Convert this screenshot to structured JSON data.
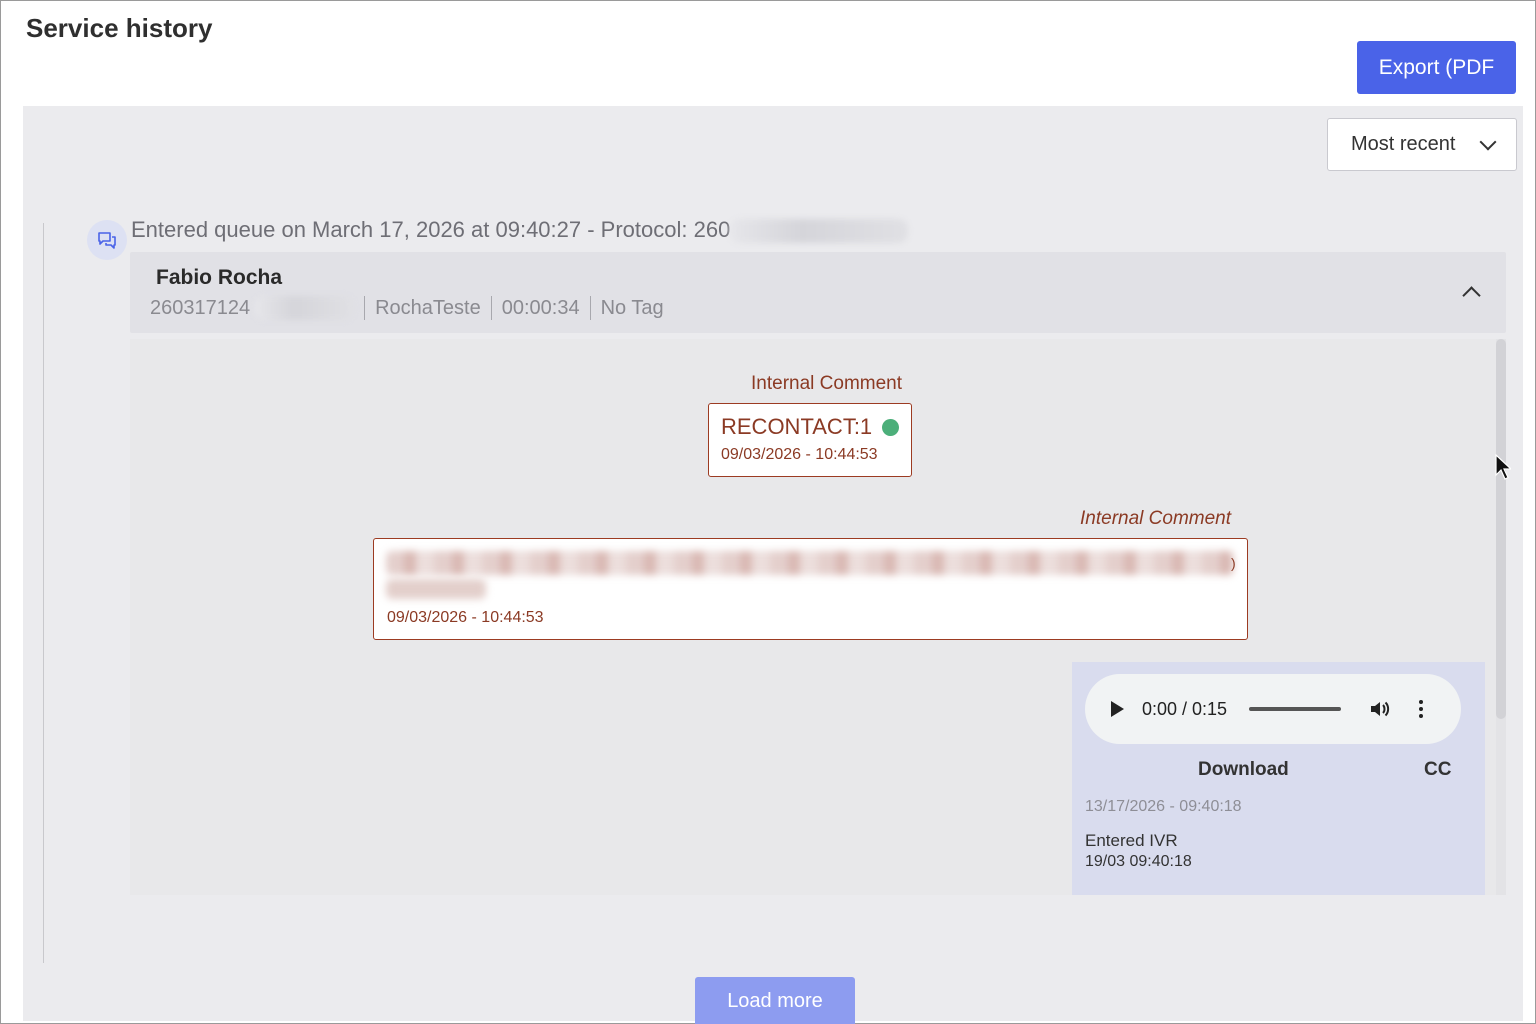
{
  "header": {
    "title": "Service history",
    "export_label": "Export (PDF"
  },
  "sort": {
    "selected": "Most recent"
  },
  "queue_entry": {
    "text": "Entered queue on March 17, 2026 at 09:40:27 - Protocol: 260",
    "icon": "chat-bubbles-icon"
  },
  "agent": {
    "name": "Fabio Rocha",
    "id": "260317124",
    "team": "RochaTeste",
    "duration": "00:00:34",
    "tag": "No Tag"
  },
  "comments": [
    {
      "title": "Internal Comment",
      "tag": "RECONTACT:1",
      "timestamp": "09/03/2026 - 10:44:53"
    },
    {
      "title": "Internal Comment",
      "trailing_char": ")",
      "timestamp": "09/03/2026 - 10:44:53"
    }
  ],
  "audio": {
    "time": "0:00 / 0:15",
    "progress": 0,
    "download_label": "Download",
    "cc_label": "CC",
    "date": "13/17/2026 - 09:40:18",
    "event_label": "Entered IVR",
    "event_time": "19/03 09:40:18"
  },
  "footer": {
    "load_more_label": "Load more"
  },
  "colors": {
    "primary": "#4a63e8",
    "comment": "#8b3a24",
    "status_dot": "#4caf7a"
  }
}
